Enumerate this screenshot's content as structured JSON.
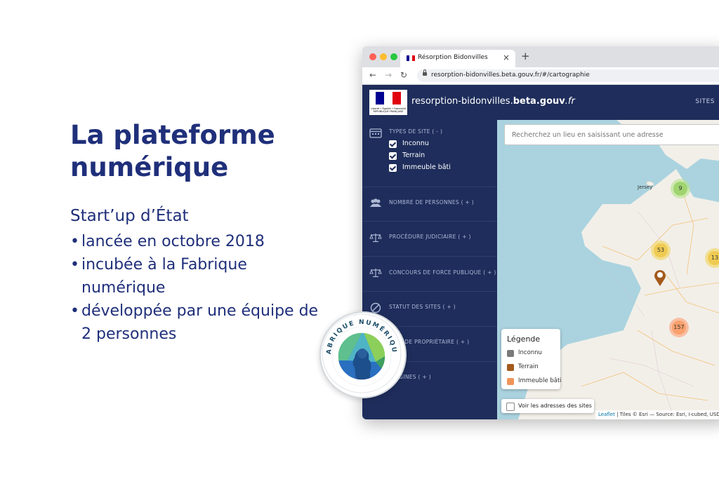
{
  "slide": {
    "title": "La plateforme numérique",
    "subtitle": "Start’up d’État",
    "bullets": [
      "lancée en octobre 2018",
      "incubée à la Fabrique numérique",
      "développée par une équipe de 2 personnes"
    ]
  },
  "browser": {
    "tab_title": "Résorption Bidonvilles",
    "tab_close": "×",
    "new_tab": "+",
    "url": "resorption-bidonvilles.beta.gouv.fr/#/cartographie"
  },
  "site": {
    "logo_text": "Liberté • Égalité • Fraternité RÉPUBLIQUE FRANÇAISE",
    "name_prefix": "resorption-bidonvilles.",
    "name_bold": "beta.gouv",
    "name_suffix": ".fr",
    "nav_sites": "SITES"
  },
  "sidebar": {
    "types_title": "TYPES DE SITE ( - )",
    "types": [
      "Inconnu",
      "Terrain",
      "Immeuble bâti"
    ],
    "filters": [
      "NOMBRE DE PERSONNES ( + )",
      "PROCÉDURE JUDICIAIRE ( + )",
      "CONCOURS DE FORCE PUBLIQUE ( + )",
      "STATUT DES SITES ( + )",
      "TYPE DE PROPRIÉTAIRE ( + )",
      "ORIGINES ( + )"
    ]
  },
  "map": {
    "search_placeholder": "Recherchez un lieu en saisissant une adresse",
    "place_label": "Jersey",
    "clusters": [
      "9",
      "53",
      "13",
      "157"
    ],
    "legend_title": "Légende",
    "legend": [
      {
        "label": "Inconnu",
        "color": "#7a7a7a"
      },
      {
        "label": "Terrain",
        "color": "#a35a1c"
      },
      {
        "label": "Immeuble bâti",
        "color": "#f0955a"
      }
    ],
    "address_toggle": "Voir les adresses des sites",
    "attribution_link": "Leaflet",
    "attribution_text": " | Tiles © Esri — Source: Esri, i-cubed, USDA"
  },
  "badge": {
    "text": "FABRIQUE NUMÉRIQUE"
  },
  "colors": {
    "brand_navy": "#1f2f7a",
    "header_navy": "#1e2d5b"
  }
}
